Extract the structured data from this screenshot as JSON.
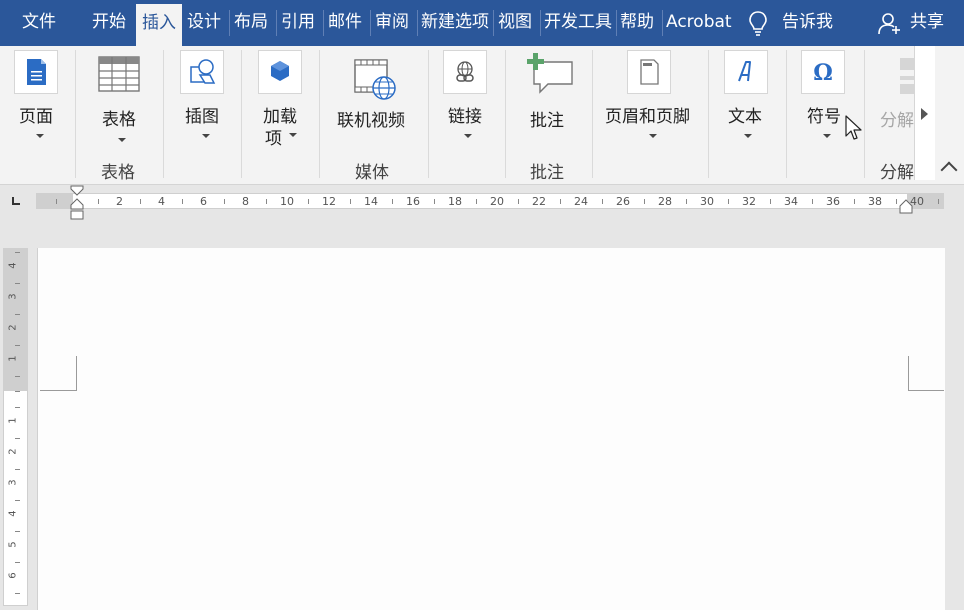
{
  "tabs": [
    {
      "label": "文件",
      "active": false
    },
    {
      "label": "开始",
      "active": false
    },
    {
      "label": "插入",
      "active": true
    },
    {
      "label": "设计",
      "active": false
    },
    {
      "label": "布局",
      "active": false
    },
    {
      "label": "引用",
      "active": false
    },
    {
      "label": "邮件",
      "active": false
    },
    {
      "label": "审阅",
      "active": false
    },
    {
      "label": "新建选项",
      "active": false
    },
    {
      "label": "视图",
      "active": false
    },
    {
      "label": "开发工具",
      "active": false
    },
    {
      "label": "帮助",
      "active": false
    },
    {
      "label": "Acrobat",
      "active": false
    }
  ],
  "tell_me": {
    "label": "告诉我",
    "icon": "lightbulb-icon"
  },
  "share": {
    "label": "共享",
    "icon": "person-icon"
  },
  "ribbon": {
    "page_btn": {
      "label": "页面",
      "icon": "page-icon"
    },
    "table_btn": {
      "label": "表格",
      "icon": "table-icon",
      "group": "表格"
    },
    "illustrations_btn": {
      "label": "插图",
      "icon": "shapes-icon"
    },
    "addins_btn": {
      "line1": "加载",
      "line2": "项",
      "icon": "addin-cube-icon"
    },
    "online_video_btn": {
      "label": "联机视频",
      "icon": "film-globe-icon",
      "group": "媒体"
    },
    "links_btn": {
      "label": "链接",
      "icon": "link-globe-icon"
    },
    "comment_btn": {
      "label": "批注",
      "icon": "comment-plus-icon",
      "group": "批注"
    },
    "header_footer_btn": {
      "label": "页眉和页脚",
      "icon": "header-page-icon"
    },
    "text_btn": {
      "label": "文本",
      "icon": "text-a-icon"
    },
    "symbols_btn": {
      "label": "符号",
      "icon": "omega-icon"
    },
    "split_btn": {
      "label": "分解",
      "icon": "split-icon",
      "group": "分解"
    }
  },
  "ruler": {
    "numbers": [
      "2",
      "4",
      "6",
      "8",
      "10",
      "12",
      "14",
      "16",
      "18",
      "20",
      "22",
      "24",
      "26",
      "28",
      "30",
      "32",
      "34",
      "36",
      "38",
      "40"
    ],
    "vertical_numbers_top": [
      "4",
      "3",
      "2",
      "1"
    ],
    "vertical_numbers_bottom": [
      "1",
      "2",
      "3",
      "4",
      "5",
      "6"
    ]
  },
  "colors": {
    "accent": "#2b579a",
    "ribbon_bg": "#f3f3f3",
    "icon_blue": "#2b6cc4",
    "icon_green": "#5aa36a"
  }
}
